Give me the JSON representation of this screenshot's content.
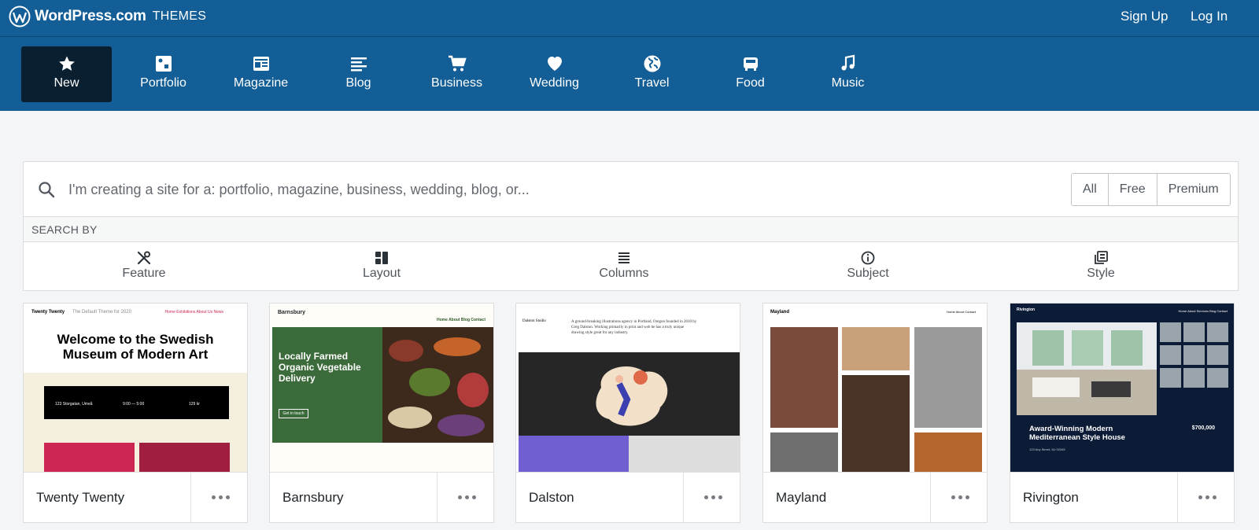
{
  "topbar": {
    "brand_name": "WordPress.com",
    "brand_sub": "THEMES",
    "signup_label": "Sign Up",
    "login_label": "Log In"
  },
  "categories": [
    {
      "label": "New",
      "icon": "star-icon",
      "active": true
    },
    {
      "label": "Portfolio",
      "icon": "portfolio-icon"
    },
    {
      "label": "Magazine",
      "icon": "magazine-icon"
    },
    {
      "label": "Blog",
      "icon": "blog-icon"
    },
    {
      "label": "Business",
      "icon": "cart-icon"
    },
    {
      "label": "Wedding",
      "icon": "heart-icon"
    },
    {
      "label": "Travel",
      "icon": "globe-icon"
    },
    {
      "label": "Food",
      "icon": "food-icon"
    },
    {
      "label": "Music",
      "icon": "music-note-icon"
    }
  ],
  "search": {
    "placeholder": "I'm creating a site for a: portfolio, magazine, business, wedding, blog, or...",
    "filters": [
      "All",
      "Free",
      "Premium"
    ],
    "search_by_label": "SEARCH BY",
    "facets": [
      {
        "label": "Feature",
        "icon": "tools-icon"
      },
      {
        "label": "Layout",
        "icon": "layout-icon"
      },
      {
        "label": "Columns",
        "icon": "columns-icon"
      },
      {
        "label": "Subject",
        "icon": "info-icon"
      },
      {
        "label": "Style",
        "icon": "style-icon"
      }
    ]
  },
  "themes": [
    {
      "name": "Twenty Twenty",
      "preview": {
        "site_title": "Twenty Twenty",
        "tagline": "The Default Theme for 2020",
        "nav": "Home   Exhibitions   About Us   News",
        "headline": "Welcome to the Swedish Museum of Modern Art",
        "info": [
          "123 Storgatan, Umeå",
          "9:00 — 5:00",
          "129 kr"
        ]
      }
    },
    {
      "name": "Barnsbury",
      "preview": {
        "site_title": "Barnsbury",
        "nav": "Home  About  Blog  Contact",
        "headline": "Locally Farmed Organic Vegetable Delivery",
        "button": "Get in touch"
      }
    },
    {
      "name": "Dalston",
      "preview": {
        "site_title": "Dalston Studio",
        "intro": "A ground-breaking illustrations agency in Portland, Oregon founded in 2010 by Greg Dalston. Working primarily in print and web he has a truly unique drawing style great for any industry."
      }
    },
    {
      "name": "Mayland",
      "preview": {
        "site_title": "Mayland",
        "nav": "Home  About  Contact"
      }
    },
    {
      "name": "Rivington",
      "preview": {
        "site_title": "Rivington",
        "nav": "Home  About  Services  Blog  Contact",
        "headline": "Award-Winning Modern Mediterranean Style House",
        "price": "$700,000",
        "address": "123 Any Street, NJ 02345"
      }
    }
  ],
  "colors": {
    "header_bg": "#135e96",
    "active_category_bg": "#0a2031",
    "page_bg": "#f3f5f6"
  }
}
